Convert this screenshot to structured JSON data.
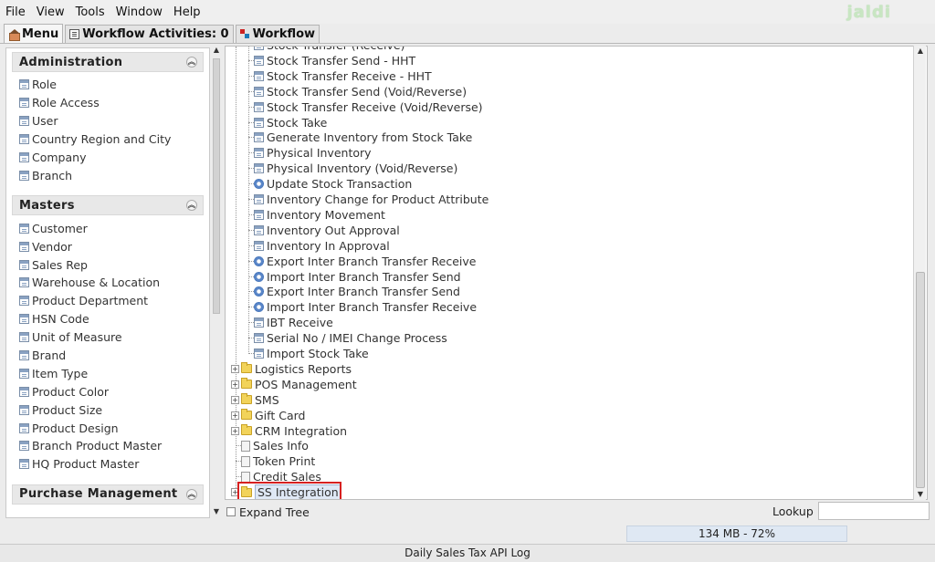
{
  "menubar": {
    "items": [
      "File",
      "View",
      "Tools",
      "Window",
      "Help"
    ],
    "logo": "jaldi"
  },
  "tabs": [
    {
      "label": "Menu",
      "icon": "home-icon"
    },
    {
      "label": "Workflow Activities: 0",
      "icon": "list-icon"
    },
    {
      "label": "Workflow",
      "icon": "workflow-icon"
    }
  ],
  "left_panel": {
    "sections": [
      {
        "title": "Administration",
        "items": [
          "Role",
          "Role Access",
          "User",
          "Country Region and City",
          "Company",
          "Branch"
        ]
      },
      {
        "title": "Masters",
        "items": [
          "Customer",
          "Vendor",
          "Sales Rep",
          "Warehouse & Location",
          "Product Department",
          "HSN Code",
          "Unit of Measure",
          "Brand",
          "Item Type",
          "Product Color",
          "Product Size",
          "Product Design",
          "Branch Product Master",
          "HQ Product Master"
        ]
      },
      {
        "title": "Purchase Management",
        "items": []
      }
    ]
  },
  "tree": {
    "children": [
      {
        "label": "Stock Transfer (Receive)",
        "icon": "window-icon"
      },
      {
        "label": "Stock Transfer Send - HHT",
        "icon": "window-icon"
      },
      {
        "label": "Stock Transfer Receive - HHT",
        "icon": "window-icon"
      },
      {
        "label": "Stock Transfer Send (Void/Reverse)",
        "icon": "window-icon"
      },
      {
        "label": "Stock Transfer Receive (Void/Reverse)",
        "icon": "window-icon"
      },
      {
        "label": "Stock Take",
        "icon": "window-icon"
      },
      {
        "label": "Generate Inventory from Stock Take",
        "icon": "window-icon"
      },
      {
        "label": "Physical Inventory",
        "icon": "window-icon"
      },
      {
        "label": "Physical Inventory (Void/Reverse)",
        "icon": "window-icon"
      },
      {
        "label": "Update Stock Transaction",
        "icon": "process-icon"
      },
      {
        "label": "Inventory Change for Product Attribute",
        "icon": "window-icon"
      },
      {
        "label": "Inventory Movement",
        "icon": "window-icon"
      },
      {
        "label": "Inventory Out Approval",
        "icon": "window-icon"
      },
      {
        "label": "Inventory In Approval",
        "icon": "window-icon"
      },
      {
        "label": "Export Inter Branch Transfer Receive",
        "icon": "process-icon"
      },
      {
        "label": "Import Inter Branch Transfer Send",
        "icon": "process-icon"
      },
      {
        "label": "Export Inter Branch Transfer Send",
        "icon": "process-icon"
      },
      {
        "label": "Import Inter Branch Transfer Receive",
        "icon": "process-icon"
      },
      {
        "label": "IBT Receive",
        "icon": "window-icon"
      },
      {
        "label": "Serial No / IMEI Change Process",
        "icon": "window-icon"
      },
      {
        "label": "Import Stock Take",
        "icon": "window-icon"
      }
    ],
    "top_level": [
      {
        "label": "Logistics Reports",
        "icon": "folder-icon"
      },
      {
        "label": "POS Management",
        "icon": "folder-icon"
      },
      {
        "label": "SMS",
        "icon": "folder-icon"
      },
      {
        "label": "Gift Card",
        "icon": "folder-icon"
      },
      {
        "label": "CRM Integration",
        "icon": "folder-icon"
      },
      {
        "label": "Sales Info",
        "icon": "report-icon"
      },
      {
        "label": "Token Print",
        "icon": "report-icon"
      },
      {
        "label": "Credit Sales",
        "icon": "report-icon"
      },
      {
        "label": "SS Integration",
        "icon": "folder-icon"
      }
    ]
  },
  "footer": {
    "expand_tree": "Expand Tree",
    "lookup": "Lookup",
    "memory": "134 MB - 72%"
  },
  "status_bar": "Daily Sales Tax API Log"
}
